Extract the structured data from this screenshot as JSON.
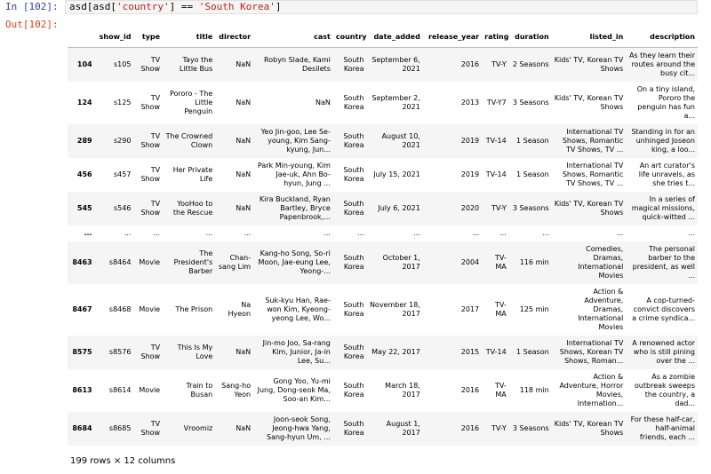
{
  "in_prompt": "In [102]:",
  "out_prompt": "Out[102]:",
  "code": {
    "pre": "asd[asd[",
    "str1": "'country'",
    "mid": "] == ",
    "str2": "'South Korea'",
    "post": "]"
  },
  "columns": [
    "",
    "show_id",
    "type",
    "title",
    "director",
    "cast",
    "country",
    "date_added",
    "release_year",
    "rating",
    "duration",
    "listed_in",
    "description"
  ],
  "rows": [
    [
      "104",
      "s105",
      "TV Show",
      "Tayo the Little Bus",
      "NaN",
      "Robyn Slade, Kami Desilets",
      "South Korea",
      "September 6, 2021",
      "2016",
      "TV-Y",
      "2 Seasons",
      "Kids' TV, Korean TV Shows",
      "As they learn their routes around the busy cit..."
    ],
    [
      "124",
      "s125",
      "TV Show",
      "Pororo - The Little Penguin",
      "NaN",
      "NaN",
      "South Korea",
      "September 2, 2021",
      "2013",
      "TV-Y7",
      "3 Seasons",
      "Kids' TV, Korean TV Shows",
      "On a tiny island, Pororo the penguin has fun a..."
    ],
    [
      "289",
      "s290",
      "TV Show",
      "The Crowned Clown",
      "NaN",
      "Yeo Jin-goo, Lee Se-young, Kim Sang-kyung, Jun...",
      "South Korea",
      "August 10, 2021",
      "2019",
      "TV-14",
      "1 Season",
      "International TV Shows, Romantic TV Shows, TV ...",
      "Standing in for an unhinged Joseon king, a loo..."
    ],
    [
      "456",
      "s457",
      "TV Show",
      "Her Private Life",
      "NaN",
      "Park Min-young, Kim Jae-uk, Ahn Bo-hyun, Jung ...",
      "South Korea",
      "July 15, 2021",
      "2019",
      "TV-14",
      "1 Season",
      "International TV Shows, Romantic TV Shows, TV ...",
      "An art curator's life unravels, as she tries t..."
    ],
    [
      "545",
      "s546",
      "TV Show",
      "YooHoo to the Rescue",
      "NaN",
      "Kira Buckland, Ryan Bartley, Bryce Papenbrook,...",
      "South Korea",
      "July 6, 2021",
      "2020",
      "TV-Y",
      "3 Seasons",
      "Kids' TV, Korean TV Shows",
      "In a series of magical missions, quick-witted ..."
    ],
    [
      "...",
      "...",
      "...",
      "...",
      "...",
      "...",
      "...",
      "...",
      "...",
      "...",
      "...",
      "...",
      "..."
    ],
    [
      "8463",
      "s8464",
      "Movie",
      "The President's Barber",
      "Chan-sang Lim",
      "Kang-ho Song, So-ri Moon, Jae-eung Lee, Yeong-...",
      "South Korea",
      "October 1, 2017",
      "2004",
      "TV-MA",
      "116 min",
      "Comedies, Dramas, International Movies",
      "The personal barber to the president, as well ..."
    ],
    [
      "8467",
      "s8468",
      "Movie",
      "The Prison",
      "Na Hyeon",
      "Suk-kyu Han, Rae-won Kim, Kyeong-yeong Lee, Wo...",
      "South Korea",
      "November 18, 2017",
      "2017",
      "TV-MA",
      "125 min",
      "Action & Adventure, Dramas, International Movies",
      "A cop-turned-convict discovers a crime syndica..."
    ],
    [
      "8575",
      "s8576",
      "TV Show",
      "This Is My Love",
      "NaN",
      "Jin-mo Joo, Sa-rang Kim, Junior, Ja-in Lee, Su...",
      "South Korea",
      "May 22, 2017",
      "2015",
      "TV-14",
      "1 Season",
      "International TV Shows, Korean TV Shows, Roman...",
      "A renowned actor who is still pining over the ..."
    ],
    [
      "8613",
      "s8614",
      "Movie",
      "Train to Busan",
      "Sang-ho Yeon",
      "Gong Yoo, Yu-mi Jung, Dong-seok Ma, Soo-an Kim...",
      "South Korea",
      "March 18, 2017",
      "2016",
      "TV-MA",
      "118 min",
      "Action & Adventure, Horror Movies, Internation...",
      "As a zombie outbreak sweeps the country, a dad..."
    ],
    [
      "8684",
      "s8685",
      "TV Show",
      "Vroomiz",
      "NaN",
      "Joon-seok Song, Jeong-hwa Yang, Sang-hyun Um, ...",
      "South Korea",
      "August 1, 2017",
      "2016",
      "TV-Y",
      "3 Seasons",
      "Kids' TV, Korean TV Shows",
      "For these half-car, half-animal friends, each ..."
    ]
  ],
  "footer": "199 rows × 12 columns"
}
